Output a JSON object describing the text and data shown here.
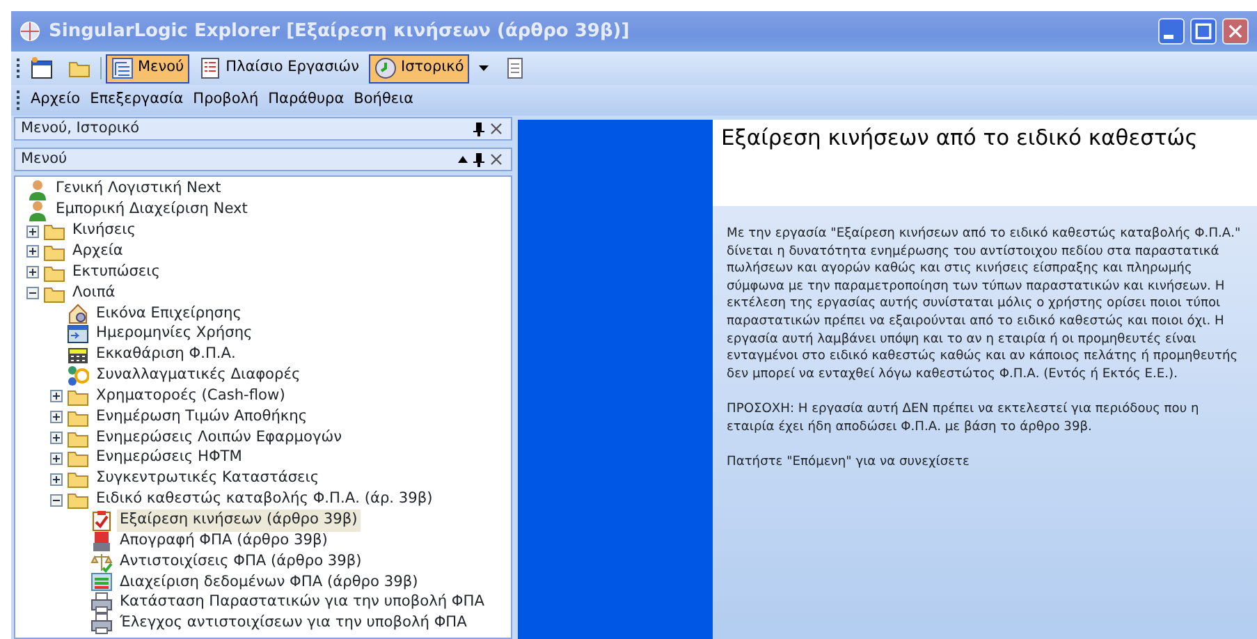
{
  "window": {
    "title": "SingularLogic Explorer [Εξαίρεση κινήσεων (άρθρο 39β)]"
  },
  "toolbar": [
    {
      "kind": "window",
      "pressed": false
    },
    {
      "kind": "folder",
      "pressed": false
    },
    {
      "kind": "tree",
      "label": "Μενού",
      "pressed": true
    },
    {
      "kind": "list",
      "label": "Πλαίσιο Εργασιών",
      "pressed": false
    },
    {
      "kind": "history",
      "label": "Ιστορικό",
      "pressed": true
    },
    {
      "kind": "doc",
      "pressed": false
    }
  ],
  "menu": [
    "Αρχείο",
    "Επεξεργασία",
    "Προβολή",
    "Παράθυρα",
    "Βοήθεια"
  ],
  "panel": {
    "title": "Μενού, Ιστορικό",
    "subtitle": "Μενού"
  },
  "tree": [
    {
      "label": "Γενική Λογιστική Next",
      "kind": "person",
      "selected": false
    },
    {
      "label": "Εμπορική Διαχείριση Next",
      "kind": "person",
      "selected": false
    },
    {
      "label": "Κινήσεις",
      "kind": "folder",
      "expanded": false,
      "selected": false
    },
    {
      "label": "Αρχεία",
      "kind": "folder",
      "expanded": false,
      "selected": false
    },
    {
      "label": "Εκτυπώσεις",
      "kind": "folder",
      "expanded": false,
      "selected": false
    },
    {
      "label": "Λοιπά",
      "kind": "folder",
      "expanded": true,
      "selected": false,
      "children": [
        {
          "label": "Εικόνα Επιχείρησης",
          "kind": "house",
          "selected": false
        },
        {
          "label": "Ημερομηνίες Χρήσης",
          "kind": "calendar",
          "selected": false
        },
        {
          "label": "Εκκαθάριση Φ.Π.Α.",
          "kind": "calculator",
          "selected": false
        },
        {
          "label": "Συναλλαγματικές Διαφορές",
          "kind": "currency",
          "selected": false
        },
        {
          "label": "Χρηματοροές (Cash-flow)",
          "kind": "folder",
          "expanded": false,
          "selected": false
        },
        {
          "label": "Ενημέρωση Τιμών Αποθήκης",
          "kind": "folder",
          "expanded": false,
          "selected": false
        },
        {
          "label": "Ενημερώσεις Λοιπών Εφαρμογών",
          "kind": "folder",
          "expanded": false,
          "selected": false
        },
        {
          "label": "Ενημερώσεις ΗΦΤΜ",
          "kind": "folder",
          "expanded": false,
          "selected": false
        },
        {
          "label": "Συγκεντρωτικές Καταστάσεις",
          "kind": "folder",
          "expanded": false,
          "selected": false
        },
        {
          "label": "Ειδικό καθεστώς καταβολής Φ.Π.Α. (άρ. 39β)",
          "kind": "folder",
          "expanded": true,
          "selected": false,
          "children": [
            {
              "label": "Εξαίρεση κινήσεων (άρθρο 39β)",
              "kind": "checklist",
              "selected": true
            },
            {
              "label": "Απογραφή ΦΠΑ (άρθρο 39β)",
              "kind": "stamp",
              "selected": false
            },
            {
              "label": "Αντιστοιχίσεις ΦΠΑ (άρθρο 39β)",
              "kind": "scale",
              "selected": false
            },
            {
              "label": "Διαχείριση δεδομένων ΦΠΑ (άρθρο 39β)",
              "kind": "data",
              "selected": false
            },
            {
              "label": "Κατάσταση Παραστατικών για την υποβολή ΦΠΑ",
              "kind": "printer",
              "selected": false
            },
            {
              "label": "Έλεγχος αντιστοιχίσεων για την υποβολή ΦΠΑ",
              "kind": "printer",
              "selected": false
            }
          ]
        }
      ]
    }
  ],
  "content": {
    "heading": "Εξαίρεση κινήσεων από το ειδικό καθεστώς",
    "paragraphs": [
      "Με την εργασία \"Εξαίρεση κινήσεων από το ειδικό καθεστώς καταβολής Φ.Π.Α.\" δίνεται η δυνατότητα ενημέρωσης του αντίστοιχου πεδίου στα παραστατικά πωλήσεων και αγορών καθώς και στις κινήσεις είσπραξης και πληρωμής σύμφωνα με την παραμετροποίηση των τύπων παραστατικών και κινήσεων. Η εκτέλεση της εργασίας αυτής συνίσταται μόλις ο χρήστης ορίσει ποιοι τύποι παραστατικών πρέπει να εξαιρούνται από το ειδικό καθεστώς και ποιοι όχι. Η εργασία αυτή λαμβάνει υπόψη και το αν η εταιρία ή οι προμηθευτές είναι ενταγμένοι στο ειδικό καθεστώς καθώς και αν κάποιος πελάτης ή προμηθευτής δεν μπορεί να ενταχθεί λόγω καθεστώτος Φ.Π.Α. (Εντός ή Εκτός Ε.Ε.).",
      "ΠΡΟΣΟΧΗ: Η εργασία αυτή ΔΕΝ πρέπει να εκτελεστεί για περιόδους που η εταιρία έχει ήδη αποδώσει Φ.Π.Α. με βάση το άρθρο 39β.",
      "Πατήστε \"Επόμενη\" για να συνεχίσετε"
    ]
  }
}
